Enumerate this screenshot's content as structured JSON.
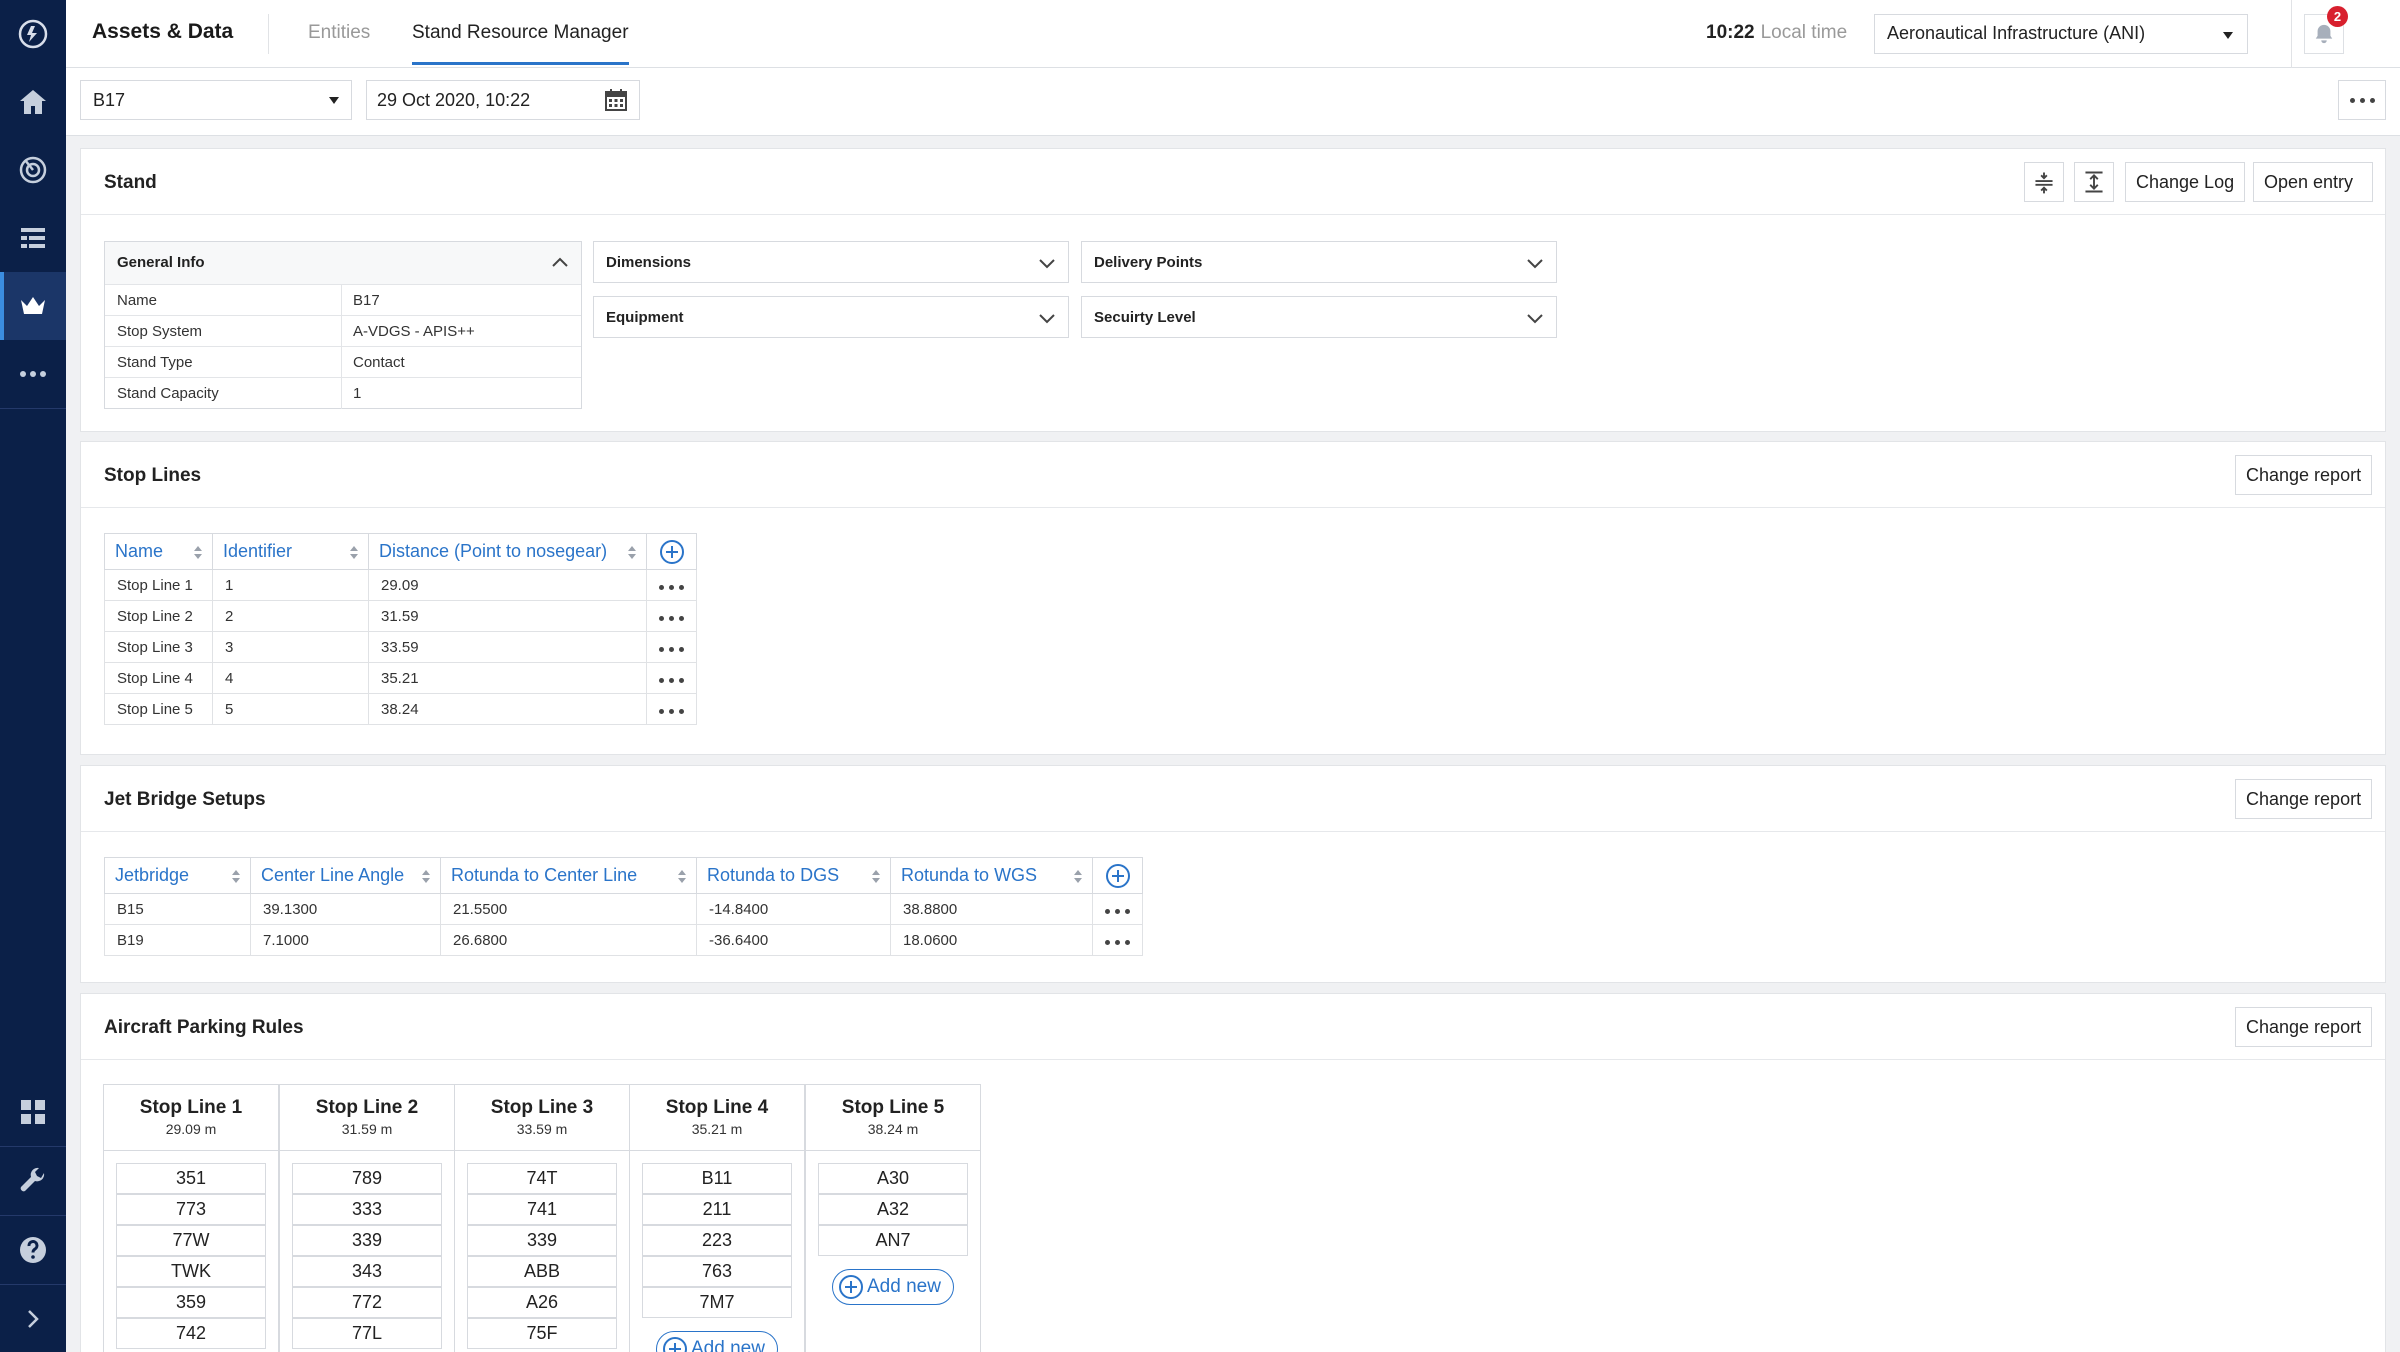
{
  "header": {
    "app_title": "Assets & Data",
    "tabs": [
      {
        "label": "Entities"
      },
      {
        "label": "Stand Resource Manager"
      }
    ],
    "time": "10:22",
    "time_label": "Local time",
    "org_select": "Aeronautical Infrastructure (ANI)",
    "notifications_count": "2"
  },
  "toolbar": {
    "stand_value": "B17",
    "date_value": "29 Oct 2020, 10:22"
  },
  "stand": {
    "title": "Stand",
    "buttons": {
      "change_log": "Change Log",
      "open_entry": "Open entry"
    },
    "general_info": {
      "title": "General Info",
      "rows": [
        {
          "key": "Name",
          "value": "B17"
        },
        {
          "key": "Stop System",
          "value": "A-VDGS - APIS++"
        },
        {
          "key": "Stand Type",
          "value": "Contact"
        },
        {
          "key": "Stand Capacity",
          "value": "1"
        }
      ]
    },
    "sections": {
      "dimensions": "Dimensions",
      "delivery_points": "Delivery Points",
      "equipment": "Equipment",
      "security_level": "Secuirty Level"
    }
  },
  "stop_lines": {
    "title": "Stop Lines",
    "change_report": "Change report",
    "columns": [
      "Name",
      "Identifier",
      "Distance (Point to nosegear)"
    ],
    "rows": [
      {
        "name": "Stop Line 1",
        "id": "1",
        "distance": "29.09"
      },
      {
        "name": "Stop Line 2",
        "id": "2",
        "distance": "31.59"
      },
      {
        "name": "Stop Line 3",
        "id": "3",
        "distance": "33.59"
      },
      {
        "name": "Stop Line 4",
        "id": "4",
        "distance": "35.21"
      },
      {
        "name": "Stop Line 5",
        "id": "5",
        "distance": "38.24"
      }
    ]
  },
  "jet_bridge": {
    "title": "Jet Bridge Setups",
    "change_report": "Change report",
    "columns": [
      "Jetbridge",
      "Center Line Angle",
      "Rotunda to Center Line",
      "Rotunda to DGS",
      "Rotunda to WGS"
    ],
    "rows": [
      {
        "jetbridge": "B15",
        "angle": "39.1300",
        "center": "21.5500",
        "dgs": "-14.8400",
        "wgs": "38.8800"
      },
      {
        "jetbridge": "B19",
        "angle": "7.1000",
        "center": "26.6800",
        "dgs": "-36.6400",
        "wgs": "18.0600"
      }
    ]
  },
  "parking_rules": {
    "title": "Aircraft Parking Rules",
    "change_report": "Change report",
    "add_new": "Add new",
    "columns": [
      {
        "name": "Stop Line 1",
        "dist": "29.09 m",
        "items": [
          "351",
          "773",
          "77W",
          "TWK",
          "359",
          "742"
        ]
      },
      {
        "name": "Stop Line 2",
        "dist": "31.59 m",
        "items": [
          "789",
          "333",
          "339",
          "343",
          "772",
          "77L"
        ]
      },
      {
        "name": "Stop Line 3",
        "dist": "33.59 m",
        "items": [
          "74T",
          "741",
          "339",
          "ABB",
          "A26",
          "75F"
        ]
      },
      {
        "name": "Stop Line 4",
        "dist": "35.21 m",
        "items": [
          "B11",
          "211",
          "223",
          "763",
          "7M7"
        ]
      },
      {
        "name": "Stop Line 5",
        "dist": "38.24 m",
        "items": [
          "A30",
          "A32",
          "AN7"
        ]
      }
    ]
  }
}
